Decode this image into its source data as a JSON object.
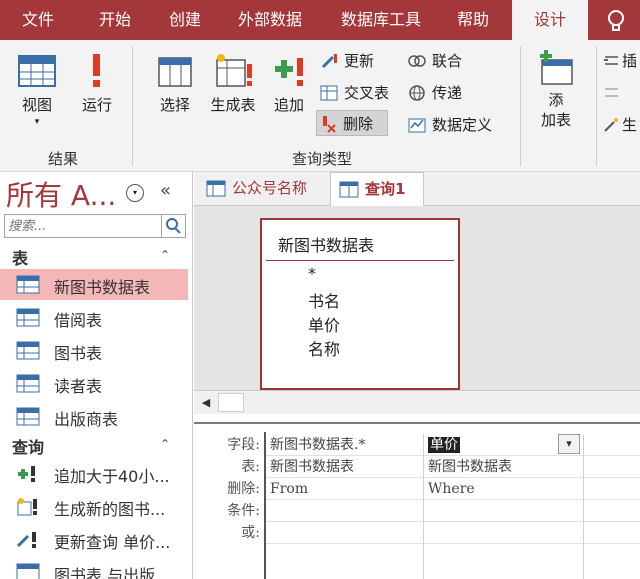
{
  "tabs": [
    "文件",
    "开始",
    "创建",
    "外部数据",
    "数据库工具",
    "帮助",
    "设计"
  ],
  "ribbon": {
    "results": {
      "view": "视图",
      "run": "运行",
      "group": "结果"
    },
    "query_type": {
      "select": "选择",
      "make_table": "生成表",
      "append": "追加",
      "update": "更新",
      "crosstab": "交叉表",
      "delete": "删除",
      "union": "联合",
      "passthrough": "传递",
      "data_definition": "数据定义",
      "group": "查询类型"
    },
    "setup": {
      "add_table": "添\n加表",
      "insert": "插",
      "delete": "",
      "builder": "生"
    }
  },
  "nav": {
    "title": "所有 A...",
    "search_placeholder": "搜索...",
    "sections": [
      {
        "label": "表",
        "items": [
          "新图书数据表",
          "借阅表",
          "图书表",
          "读者表",
          "出版商表"
        ]
      },
      {
        "label": "查询",
        "items": [
          "追加大于40小...",
          "生成新的图书...",
          "更新查询 单价...",
          "图书表 与出版..."
        ]
      }
    ]
  },
  "doc_tabs": [
    {
      "label": "公众号名称",
      "active": false
    },
    {
      "label": "查询1",
      "active": true
    }
  ],
  "table_box": {
    "title": "新图书数据表",
    "fields": [
      "*",
      "书名",
      "单价",
      "名称"
    ]
  },
  "qbe": {
    "row_labels": [
      "字段:",
      "表:",
      "删除:",
      "条件:",
      "或:"
    ],
    "columns": [
      {
        "field": "新图书数据表.*",
        "table": "新图书数据表",
        "delete": "From"
      },
      {
        "field": "单价",
        "table": "新图书数据表",
        "delete": "Where"
      }
    ]
  },
  "colors": {
    "accent": "#a4373a",
    "nav_selected": "#f4b7b7"
  }
}
